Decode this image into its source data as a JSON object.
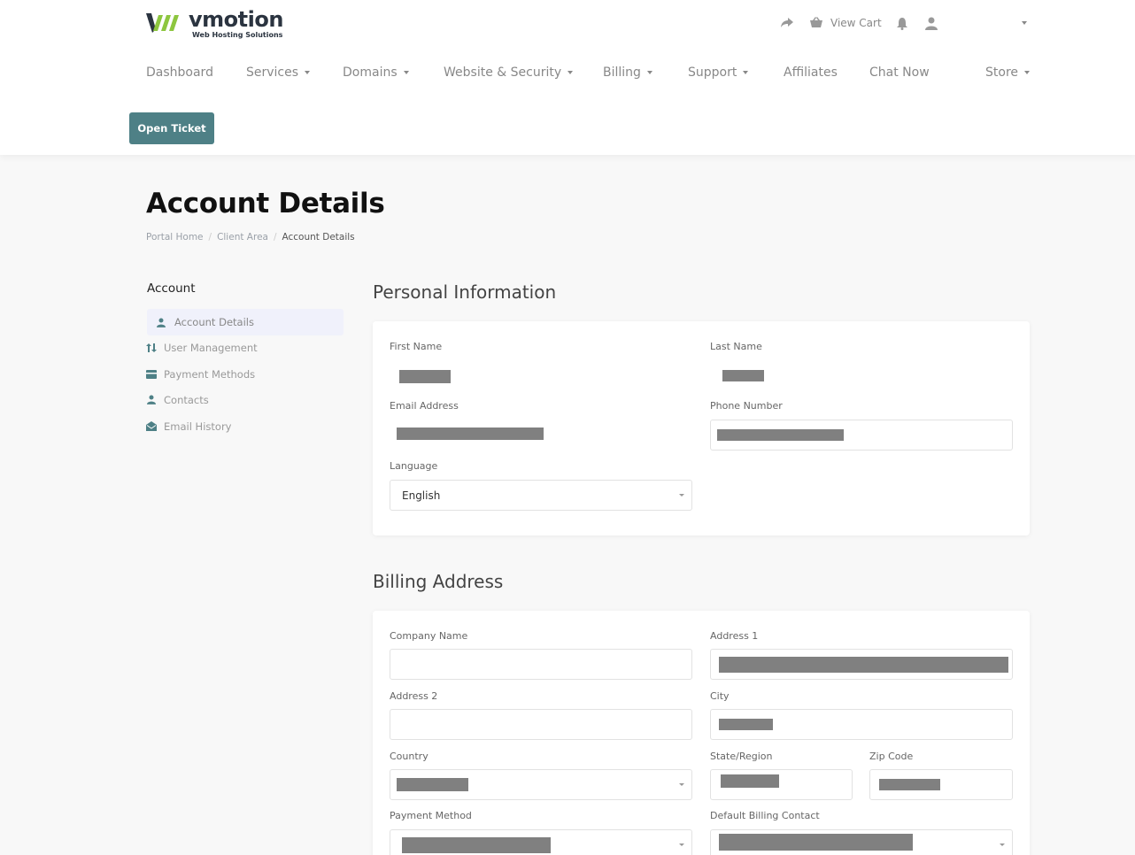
{
  "brand": {
    "name": "vmotion",
    "tagline": "Web Hosting Solutions",
    "accent": "#4e8086",
    "logo_green": "#8dc63f"
  },
  "topbar": {
    "view_cart": "View Cart"
  },
  "nav": {
    "items": [
      {
        "label": "Dashboard",
        "dropdown": false
      },
      {
        "label": "Services",
        "dropdown": true
      },
      {
        "label": "Domains",
        "dropdown": true
      },
      {
        "label": "Website & Security",
        "dropdown": true
      },
      {
        "label": "Billing",
        "dropdown": true
      },
      {
        "label": "Support",
        "dropdown": true
      },
      {
        "label": "Affiliates",
        "dropdown": false
      },
      {
        "label": "Chat Now",
        "dropdown": false
      },
      {
        "label": "Store",
        "dropdown": true
      }
    ]
  },
  "open_ticket": "Open Ticket",
  "page": {
    "title": "Account Details",
    "breadcrumb": [
      "Portal Home",
      "Client Area",
      "Account Details"
    ]
  },
  "sidebar": {
    "title": "Account",
    "items": [
      {
        "label": "Account Details",
        "icon": "user-icon",
        "active": true
      },
      {
        "label": "User Management",
        "icon": "sort-arrows-icon",
        "active": false
      },
      {
        "label": "Payment Methods",
        "icon": "credit-card-icon",
        "active": false
      },
      {
        "label": "Contacts",
        "icon": "user-icon",
        "active": false
      },
      {
        "label": "Email History",
        "icon": "envelope-open-icon",
        "active": false
      }
    ]
  },
  "personal": {
    "title": "Personal Information",
    "first_name_label": "First Name",
    "last_name_label": "Last Name",
    "email_label": "Email Address",
    "phone_label": "Phone Number",
    "language_label": "Language",
    "language_value": "English"
  },
  "billing": {
    "title": "Billing Address",
    "company_label": "Company Name",
    "address1_label": "Address 1",
    "address2_label": "Address 2",
    "city_label": "City",
    "country_label": "Country",
    "state_label": "State/Region",
    "zip_label": "Zip Code",
    "payment_method_label": "Payment Method",
    "default_contact_label": "Default Billing Contact"
  }
}
